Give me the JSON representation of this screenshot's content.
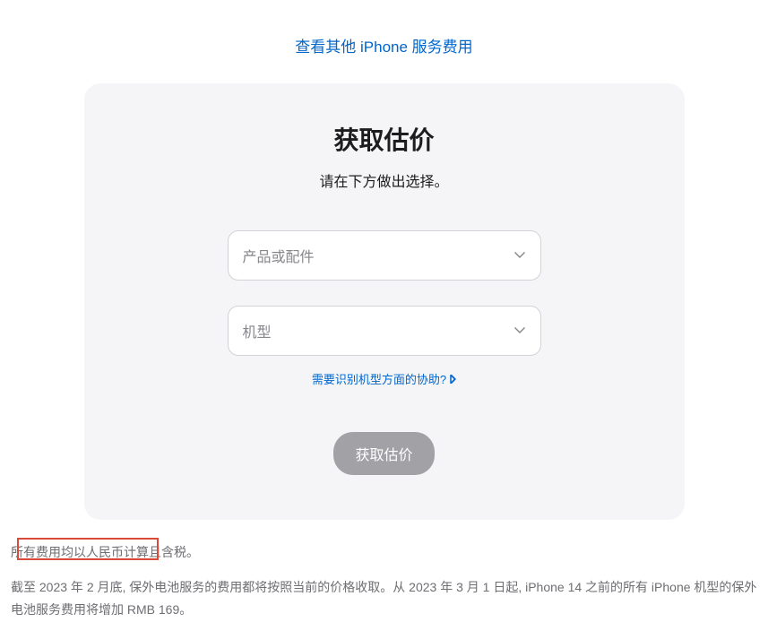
{
  "top_link": {
    "text": "查看其他 iPhone 服务费用"
  },
  "card": {
    "title": "获取估价",
    "subtitle": "请在下方做出选择。",
    "select_product": {
      "placeholder": "产品或配件"
    },
    "select_model": {
      "placeholder": "机型"
    },
    "help_link": "需要识别机型方面的协助?",
    "submit_label": "获取估价"
  },
  "footer": {
    "note1": "所有费用均以人民币计算且含税。",
    "note2": "截至 2023 年 2 月底, 保外电池服务的费用都将按照当前的价格收取。从 2023 年 3 月 1 日起, iPhone 14 之前的所有 iPhone 机型的保外电池服务费用将增加 RMB 169。"
  }
}
